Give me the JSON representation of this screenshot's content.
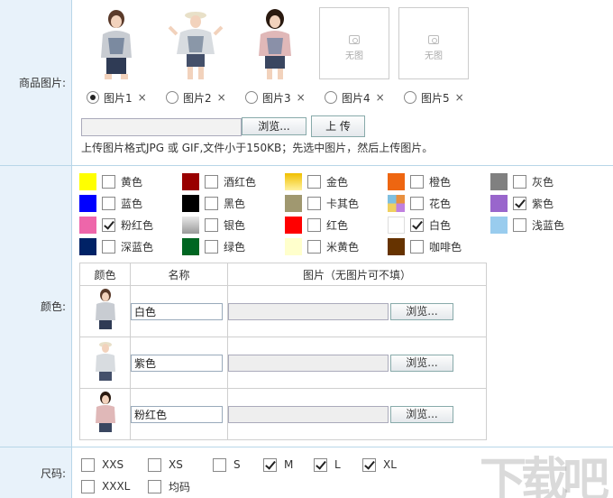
{
  "product_images": {
    "label": "商品图片:",
    "placeholder_text": "无图",
    "slots": [
      {
        "label": "图片1",
        "selected": true
      },
      {
        "label": "图片2",
        "selected": false
      },
      {
        "label": "图片3",
        "selected": false
      },
      {
        "label": "图片4",
        "selected": false
      },
      {
        "label": "图片5",
        "selected": false
      }
    ],
    "delete_glyph": "×",
    "browse_label": "浏览...",
    "upload_label": "上 传",
    "hint": "上传图片格式JPG 或 GIF,文件小于150KB；先选中图片，然后上传图片。"
  },
  "colors": {
    "label": "颜色:",
    "items": [
      {
        "name": "黄色",
        "hex": "#ffff00",
        "checked": false
      },
      {
        "name": "酒红色",
        "hex": "#990000",
        "checked": false
      },
      {
        "name": "金色",
        "hex": "#f0c000",
        "checked": false
      },
      {
        "name": "橙色",
        "hex": "#ee6611",
        "checked": false
      },
      {
        "name": "灰色",
        "hex": "#808080",
        "checked": false
      },
      {
        "name": "蓝色",
        "hex": "#0000ff",
        "checked": false
      },
      {
        "name": "黑色",
        "hex": "#000000",
        "checked": false
      },
      {
        "name": "卡其色",
        "hex": "#a09870",
        "checked": false
      },
      {
        "name": "花色",
        "hex": "#e89040",
        "checked": false
      },
      {
        "name": "紫色",
        "hex": "#9966cc",
        "checked": true
      },
      {
        "name": "粉红色",
        "hex": "#ee66aa",
        "checked": true
      },
      {
        "name": "银色",
        "hex": "#c0c0c0",
        "checked": false
      },
      {
        "name": "红色",
        "hex": "#ff0000",
        "checked": false
      },
      {
        "name": "白色",
        "hex": "#ffffff",
        "checked": true
      },
      {
        "name": "浅蓝色",
        "hex": "#99ccee",
        "checked": false
      },
      {
        "name": "深蓝色",
        "hex": "#002266",
        "checked": false
      },
      {
        "name": "绿色",
        "hex": "#006622",
        "checked": false
      },
      {
        "name": "米黄色",
        "hex": "#ffffcc",
        "checked": false
      },
      {
        "name": "咖啡色",
        "hex": "#663300",
        "checked": false
      }
    ],
    "table": {
      "headers": [
        "颜色",
        "名称",
        "图片（无图片可不填）"
      ],
      "rows": [
        {
          "name": "白色",
          "browse": "浏览..."
        },
        {
          "name": "紫色",
          "browse": "浏览..."
        },
        {
          "name": "粉红色",
          "browse": "浏览..."
        }
      ]
    }
  },
  "sizes": {
    "label": "尺码:",
    "items": [
      {
        "name": "XXS",
        "checked": false
      },
      {
        "name": "XS",
        "checked": false
      },
      {
        "name": "S",
        "checked": false
      },
      {
        "name": "M",
        "checked": true
      },
      {
        "name": "L",
        "checked": true
      },
      {
        "name": "XL",
        "checked": true
      },
      {
        "name": "XXXL",
        "checked": false
      },
      {
        "name": "均码",
        "checked": false
      }
    ]
  }
}
